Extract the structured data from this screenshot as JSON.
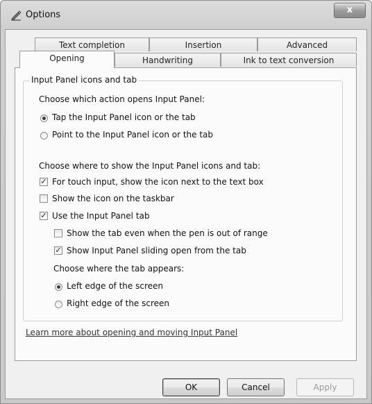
{
  "window": {
    "title": "Options",
    "close_label": "x"
  },
  "tabs_row1": [
    "Text completion",
    "Insertion",
    "Advanced"
  ],
  "tabs_row2": [
    "Opening",
    "Handwriting",
    "Ink to text conversion"
  ],
  "group": {
    "legend": "Input Panel icons and tab",
    "q1": "Choose which action opens Input Panel:",
    "radio_tap": "Tap the Input Panel icon or the tab",
    "radio_point": "Point to the Input Panel icon or the tab",
    "q2": "Choose where to show the Input Panel icons and tab:",
    "check_touch": "For touch input, show the icon next to the text box",
    "check_taskbar": "Show the icon on the taskbar",
    "check_tab": "Use the Input Panel tab",
    "check_out_of_range": "Show the tab even when the pen is out of range",
    "check_sliding": "Show Input Panel sliding open from the tab",
    "q3": "Choose where the tab appears:",
    "radio_left": "Left edge of the screen",
    "radio_right": "Right edge of the screen"
  },
  "link": "Learn more about opening and moving Input Panel",
  "buttons": {
    "ok": "OK",
    "cancel": "Cancel",
    "apply": "Apply"
  },
  "state": {
    "selected_tab": "Opening",
    "open_action": "Tap the Input Panel icon or the tab",
    "touch_checked": true,
    "taskbar_checked": false,
    "use_tab_checked": true,
    "out_of_range_checked": false,
    "sliding_checked": true,
    "tab_edge": "Left edge of the screen",
    "apply_enabled": false
  },
  "icons": {
    "title": "pen-options-icon",
    "close": "close-icon"
  }
}
